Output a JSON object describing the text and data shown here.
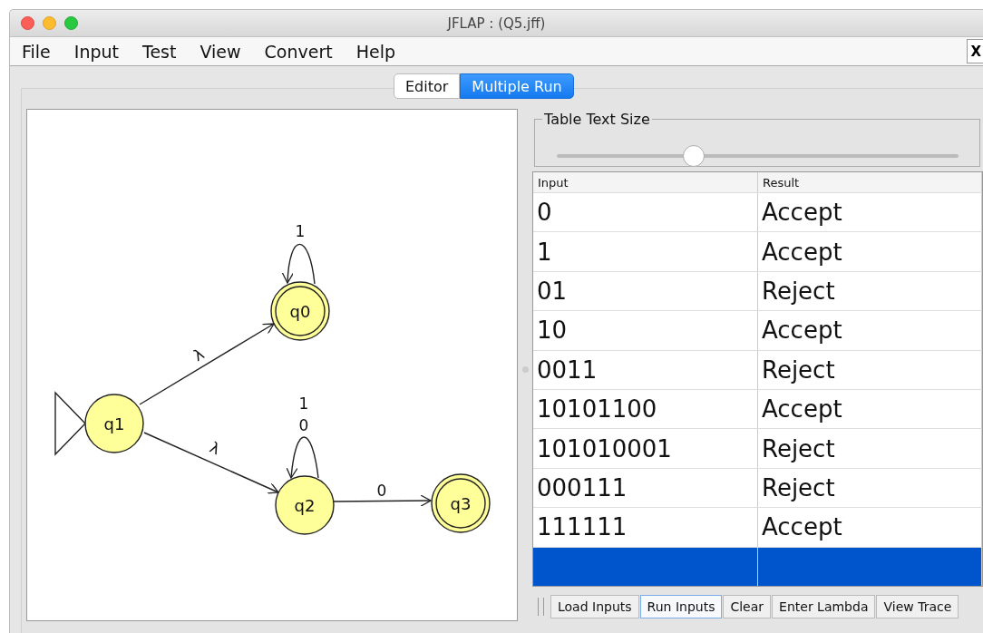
{
  "window": {
    "title": "JFLAP : (Q5.jff)"
  },
  "menu": [
    "File",
    "Input",
    "Test",
    "View",
    "Convert",
    "Help"
  ],
  "menu_close": "X",
  "tabs": [
    {
      "label": "Editor",
      "selected": false
    },
    {
      "label": "Multiple Run",
      "selected": true
    }
  ],
  "automaton": {
    "states": [
      {
        "label": "q0",
        "initial": false,
        "final": true
      },
      {
        "label": "q1",
        "initial": true,
        "final": false
      },
      {
        "label": "q2",
        "initial": false,
        "final": false
      },
      {
        "label": "q3",
        "initial": false,
        "final": true
      }
    ],
    "transitions": [
      {
        "label": "λ"
      },
      {
        "label": "λ"
      },
      {
        "label": "1"
      },
      {
        "label": "1"
      },
      {
        "label": "0"
      },
      {
        "label": "0"
      }
    ]
  },
  "slider": {
    "title": "Table Text Size",
    "level": 0.34
  },
  "table": {
    "columns": [
      "Input",
      "Result"
    ],
    "rows": [
      {
        "input": "0",
        "result": "Accept",
        "selected": false
      },
      {
        "input": "1",
        "result": "Accept",
        "selected": false
      },
      {
        "input": "01",
        "result": "Reject",
        "selected": false
      },
      {
        "input": "10",
        "result": "Accept",
        "selected": false
      },
      {
        "input": "0011",
        "result": "Reject",
        "selected": false
      },
      {
        "input": "10101100",
        "result": "Accept",
        "selected": false
      },
      {
        "input": "101010001",
        "result": "Reject",
        "selected": false
      },
      {
        "input": "000111",
        "result": "Reject",
        "selected": false
      },
      {
        "input": "111111",
        "result": "Accept",
        "selected": false
      },
      {
        "selected": true
      }
    ]
  },
  "buttons": [
    {
      "label": "Load Inputs",
      "focused": false
    },
    {
      "label": "Run Inputs",
      "focused": true
    },
    {
      "label": "Clear",
      "focused": false
    },
    {
      "label": "Enter Lambda",
      "focused": false
    },
    {
      "label": "View Trace",
      "focused": false
    }
  ]
}
